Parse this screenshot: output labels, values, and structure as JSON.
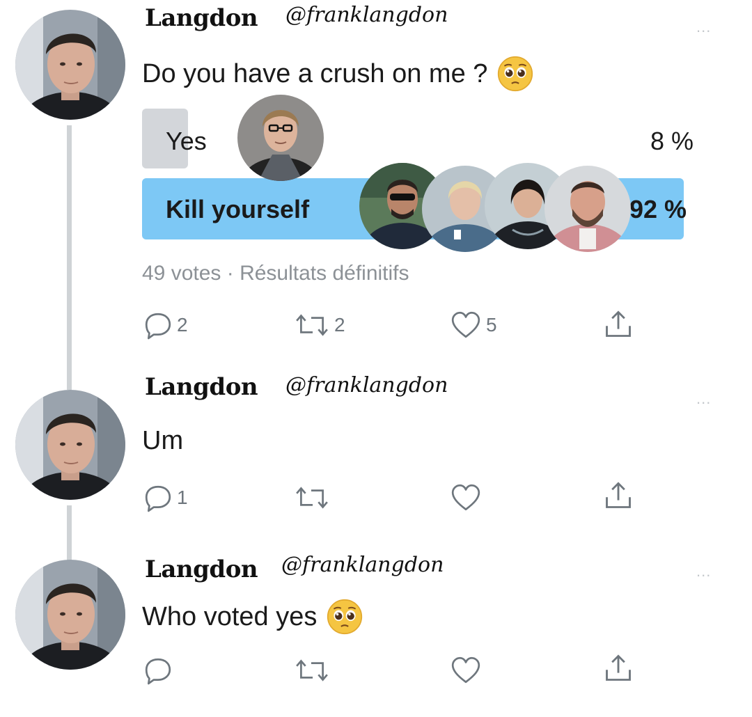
{
  "tweets": [
    {
      "name": "Langdon",
      "handle": "@franklangdon",
      "more": "...",
      "text": "Do you have a crush on me ?",
      "emoji": "pleading-face",
      "poll": {
        "options": [
          {
            "label": "Yes",
            "percent_text": "8 %",
            "percent": 8,
            "winner": false
          },
          {
            "label": "Kill yourself",
            "percent_text": "92 %",
            "percent": 92,
            "winner": true
          }
        ],
        "summary": "49 votes · Résultats définitifs"
      },
      "actions": {
        "reply_count": "2",
        "retweet_count": "2",
        "like_count": "5"
      }
    },
    {
      "name": "Langdon",
      "handle": "@franklangdon",
      "more": "...",
      "text": "Um",
      "actions": {
        "reply_count": "1",
        "retweet_count": "",
        "like_count": ""
      }
    },
    {
      "name": "Langdon",
      "handle": "@franklangdon",
      "more": "...",
      "text": "Who voted yes",
      "emoji": "pleading-face",
      "actions": {
        "reply_count": "",
        "retweet_count": "",
        "like_count": ""
      }
    }
  ],
  "colors": {
    "winner_bar": "#7dc8f5",
    "loser_bar": "#d3d6da",
    "thread_line": "#cfd3d6",
    "muted_text": "#8c9196"
  },
  "icons": [
    "reply-icon",
    "retweet-icon",
    "like-icon",
    "share-icon",
    "more-icon",
    "pleading-face-emoji"
  ]
}
